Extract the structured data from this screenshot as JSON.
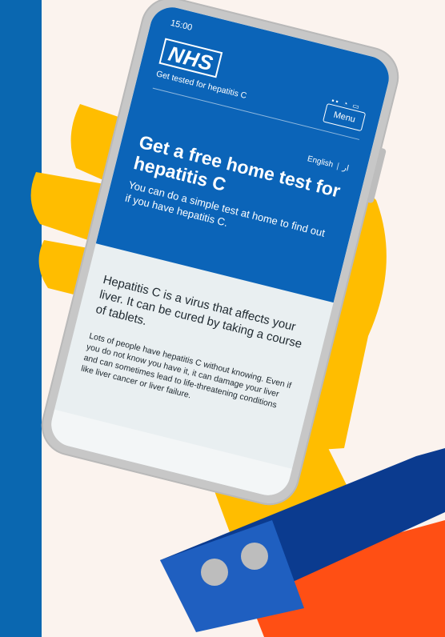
{
  "status_bar": {
    "time": "15:00",
    "icons": "signal-icon wifi-icon battery-icon"
  },
  "header": {
    "logo_text": "NHS",
    "service_name": "Get tested for hepatitis C",
    "menu_label": "Menu"
  },
  "language": {
    "english": "English",
    "other_icon": "language-icon"
  },
  "hero": {
    "title": "Get a free home test for hepatitis C",
    "subtitle": "You can do a simple test at home to find out if you have hepatitis C."
  },
  "content": {
    "lead": "Hepatitis C is a virus that affects your liver. It can be cured by taking a course of tablets.",
    "body": "Lots of people have hepatitis C without knowing. Even if you do not know you have it, it can damage your liver and can sometimes lead to life-threatening conditions like liver cancer or liver failure."
  },
  "colors": {
    "nhs_blue": "#0b64b8",
    "stripe_blue": "#0a67b0",
    "hand_yellow": "#ffbd00",
    "sleeve_navy": "#0b3b8f",
    "cuff_blue": "#1f5fc0",
    "orange": "#ff4f14",
    "background": "#fbf3ee"
  }
}
